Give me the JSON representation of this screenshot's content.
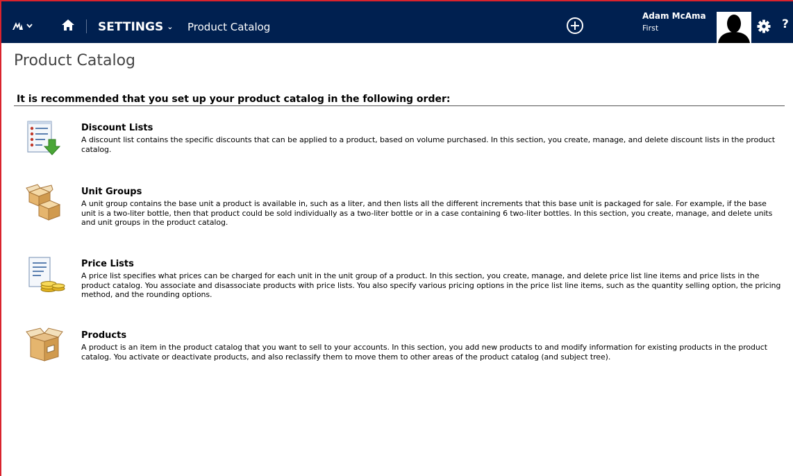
{
  "nav": {
    "settings_label": "SETTINGS",
    "page_label": "Product Catalog",
    "user_name": "Adam McAma",
    "user_org": "First",
    "help_label": "?",
    "icons": {
      "logo": "dynamics-logo-icon",
      "logo_menu": "chevron-down-icon",
      "home": "home-icon",
      "create": "plus-circle-icon",
      "avatar": "user-avatar-icon",
      "settings": "gear-icon",
      "help": "help-icon"
    },
    "colors": {
      "bar": "#002050",
      "text": "#ffffff"
    }
  },
  "page": {
    "title": "Product Catalog",
    "intro": "It is recommended that you set up your product catalog in the following order:"
  },
  "sections": [
    {
      "title": "Discount Lists",
      "icon": "discount-list-icon",
      "description": "A discount list contains the specific discounts that can be applied to a product, based on volume purchased. In this section, you create, manage, and delete discount lists in the product catalog."
    },
    {
      "title": "Unit Groups",
      "icon": "unit-groups-icon",
      "description": "A unit group contains the base unit a product is available in, such as a liter, and then lists all the different increments that this base unit is packaged for sale. For example, if the base unit is a two-liter bottle, then that product could be sold individually as a two-liter bottle or in a case containing 6 two-liter bottles. In this section, you create, manage, and delete units and unit groups in the product catalog."
    },
    {
      "title": "Price Lists",
      "icon": "price-list-icon",
      "description": "A price list specifies what prices can be charged for each unit in the unit group of a product. In this section, you create, manage, and delete price list line items and price lists in the product catalog. You associate and disassociate products with price lists. You also specify various pricing options in the price list line items, such as the quantity selling option, the pricing method, and the rounding options."
    },
    {
      "title": "Products",
      "icon": "product-box-icon",
      "description": "A product is an item in the product catalog that you want to sell to your accounts. In this section, you add new products to and modify information for existing products in the product catalog. You activate or deactivate products, and also reclassify them to move them to other areas of the product catalog (and subject tree)."
    }
  ]
}
